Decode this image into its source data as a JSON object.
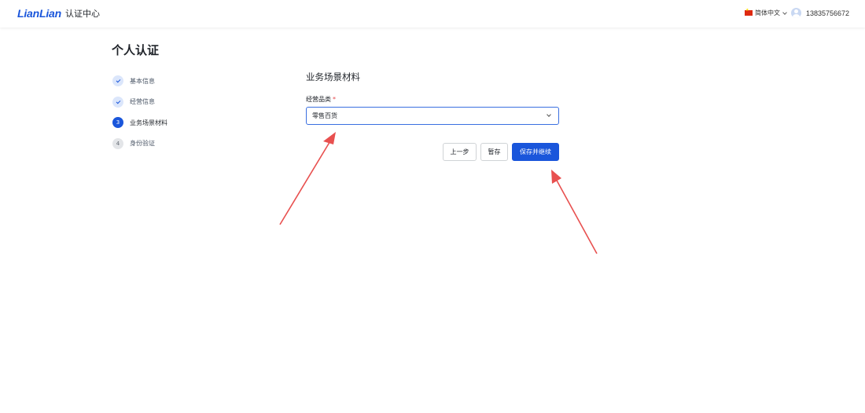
{
  "header": {
    "brand": "LianLian",
    "subtitle": "认证中心",
    "language": "简体中文",
    "phone": "13835756672"
  },
  "page": {
    "title": "个人认证"
  },
  "steps": [
    {
      "number": "1",
      "label": "基本信息",
      "state": "done"
    },
    {
      "number": "2",
      "label": "经营信息",
      "state": "done"
    },
    {
      "number": "3",
      "label": "业务场景材料",
      "state": "active"
    },
    {
      "number": "4",
      "label": "身份验证",
      "state": "todo"
    }
  ],
  "form": {
    "section_title": "业务场景材料",
    "category_label": "经营品类",
    "required_mark": "*",
    "category_value": "零售百货"
  },
  "actions": {
    "prev_label": "上一步",
    "draft_label": "暂存",
    "next_label": "保存并继续"
  },
  "colors": {
    "accent": "#1a56db",
    "annotation_arrow": "#e8504f"
  }
}
